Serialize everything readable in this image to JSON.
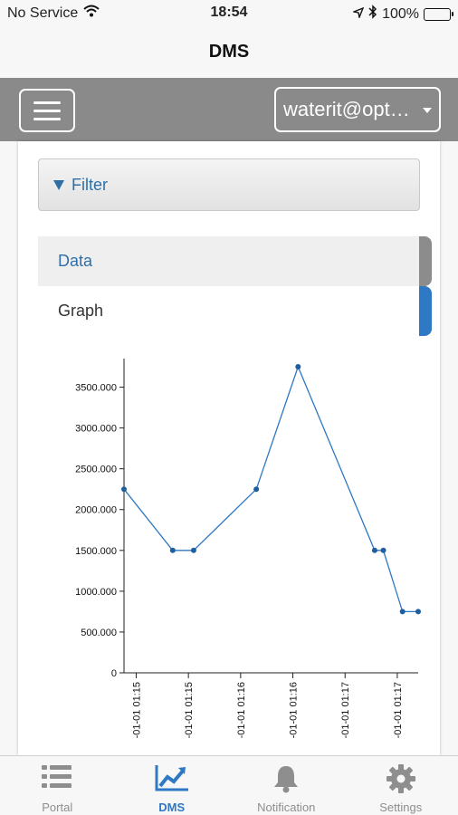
{
  "status_bar": {
    "carrier": "No Service",
    "time": "18:54",
    "battery": "100%"
  },
  "header": {
    "title": "DMS"
  },
  "toolbar": {
    "account": "waterit@opt…"
  },
  "filter": {
    "label": "Filter"
  },
  "tabs": [
    {
      "label": "Data",
      "active": false
    },
    {
      "label": "Graph",
      "active": true
    }
  ],
  "chart_data": {
    "type": "line",
    "title": "",
    "xlabel": "",
    "ylabel": "",
    "ylim": [
      0,
      3850
    ],
    "yticks": [
      0,
      500,
      1000,
      1500,
      2000,
      2500,
      3000,
      3500
    ],
    "ytick_labels": [
      "0",
      "500.000",
      "1000.000",
      "1500.000",
      "2000.000",
      "2500.000",
      "3000.000",
      "3500.000"
    ],
    "xticks": [
      {
        "time": "01:15:00",
        "label": "-01-01 01:15"
      },
      {
        "time": "01:15:30",
        "label": "-01-01 01:15"
      },
      {
        "time": "01:16:00",
        "label": "-01-01 01:16"
      },
      {
        "time": "01:16:30",
        "label": "-01-01 01:16"
      },
      {
        "time": "01:17:00",
        "label": "-01-01 01:17"
      },
      {
        "time": "01:17:30",
        "label": "-01-01 01:17"
      }
    ],
    "x_domain": [
      "01:14:53",
      "01:17:42"
    ],
    "points": [
      {
        "x": "01:14:53",
        "y": 2250
      },
      {
        "x": "01:15:21",
        "y": 1500
      },
      {
        "x": "01:15:33",
        "y": 1500
      },
      {
        "x": "01:16:09",
        "y": 2250
      },
      {
        "x": "01:16:33",
        "y": 3750
      },
      {
        "x": "01:17:17",
        "y": 1500
      },
      {
        "x": "01:17:22",
        "y": 1500
      },
      {
        "x": "01:17:33",
        "y": 750
      },
      {
        "x": "01:17:42",
        "y": 750
      }
    ],
    "line_color": "#2f78c4",
    "grid": false
  },
  "tabbar": [
    {
      "label": "Portal",
      "icon": "list-icon",
      "active": false
    },
    {
      "label": "DMS",
      "icon": "chart-line-icon",
      "active": true
    },
    {
      "label": "Notification",
      "icon": "bell-icon",
      "active": false
    },
    {
      "label": "Settings",
      "icon": "gear-icon",
      "active": false
    }
  ],
  "colors": {
    "accent": "#2f78c4",
    "toolbar": "#8a8a8a",
    "inactive": "#8e8e8e"
  }
}
